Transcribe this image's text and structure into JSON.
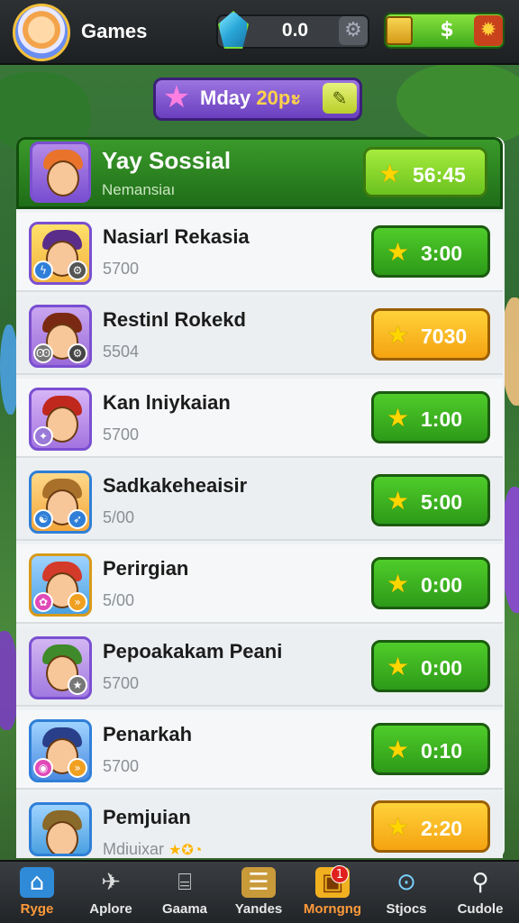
{
  "topbar": {
    "title": "Games",
    "gem_value": "0.0",
    "cash_value": "$"
  },
  "event": {
    "label_a": "Mday ",
    "label_b": "20pะ"
  },
  "featured": {
    "name": "Yay Sossial",
    "sub": "Nemansiaı",
    "button_value": "56:45"
  },
  "rows": [
    {
      "name": "Nasiarl Rekasia",
      "sub": "5700",
      "button_value": "3:00",
      "button_style": "green"
    },
    {
      "name": "Restinl Rokekd",
      "sub": "5504",
      "button_value": "7030",
      "button_style": "gold"
    },
    {
      "name": "Kan lniykaian",
      "sub": "5700",
      "button_value": "1:00",
      "button_style": "green"
    },
    {
      "name": "Sadkakeheaisir",
      "sub": "5/00",
      "button_value": "5:00",
      "button_style": "green"
    },
    {
      "name": "Perirgian",
      "sub": "5/00",
      "button_value": "0:00",
      "button_style": "green"
    },
    {
      "name": "Pepoakakam Peani",
      "sub": "5700",
      "button_value": "0:00",
      "button_style": "green"
    },
    {
      "name": "Penarkah",
      "sub": "5700",
      "button_value": "0:10",
      "button_style": "green"
    },
    {
      "name": "Pemjuian",
      "sub": "Mdiuixar",
      "button_value": "2:20",
      "button_style": "gold"
    }
  ],
  "nav": {
    "items": [
      {
        "label": "Ryge",
        "icon": "home-icon"
      },
      {
        "label": "Aplore",
        "icon": "explore-icon"
      },
      {
        "label": "Gaama",
        "icon": "gamepad-icon"
      },
      {
        "label": "Yandes",
        "icon": "cards-icon"
      },
      {
        "label": "Morngng",
        "icon": "chest-icon"
      },
      {
        "label": "Stjocs",
        "icon": "search-icon"
      },
      {
        "label": "Cudole",
        "icon": "magnifier-icon"
      }
    ],
    "badge": "1"
  },
  "colors": {
    "green_button": "#2d9a18",
    "gold_button": "#f5a311",
    "accent_purple": "#6a3fbf"
  }
}
